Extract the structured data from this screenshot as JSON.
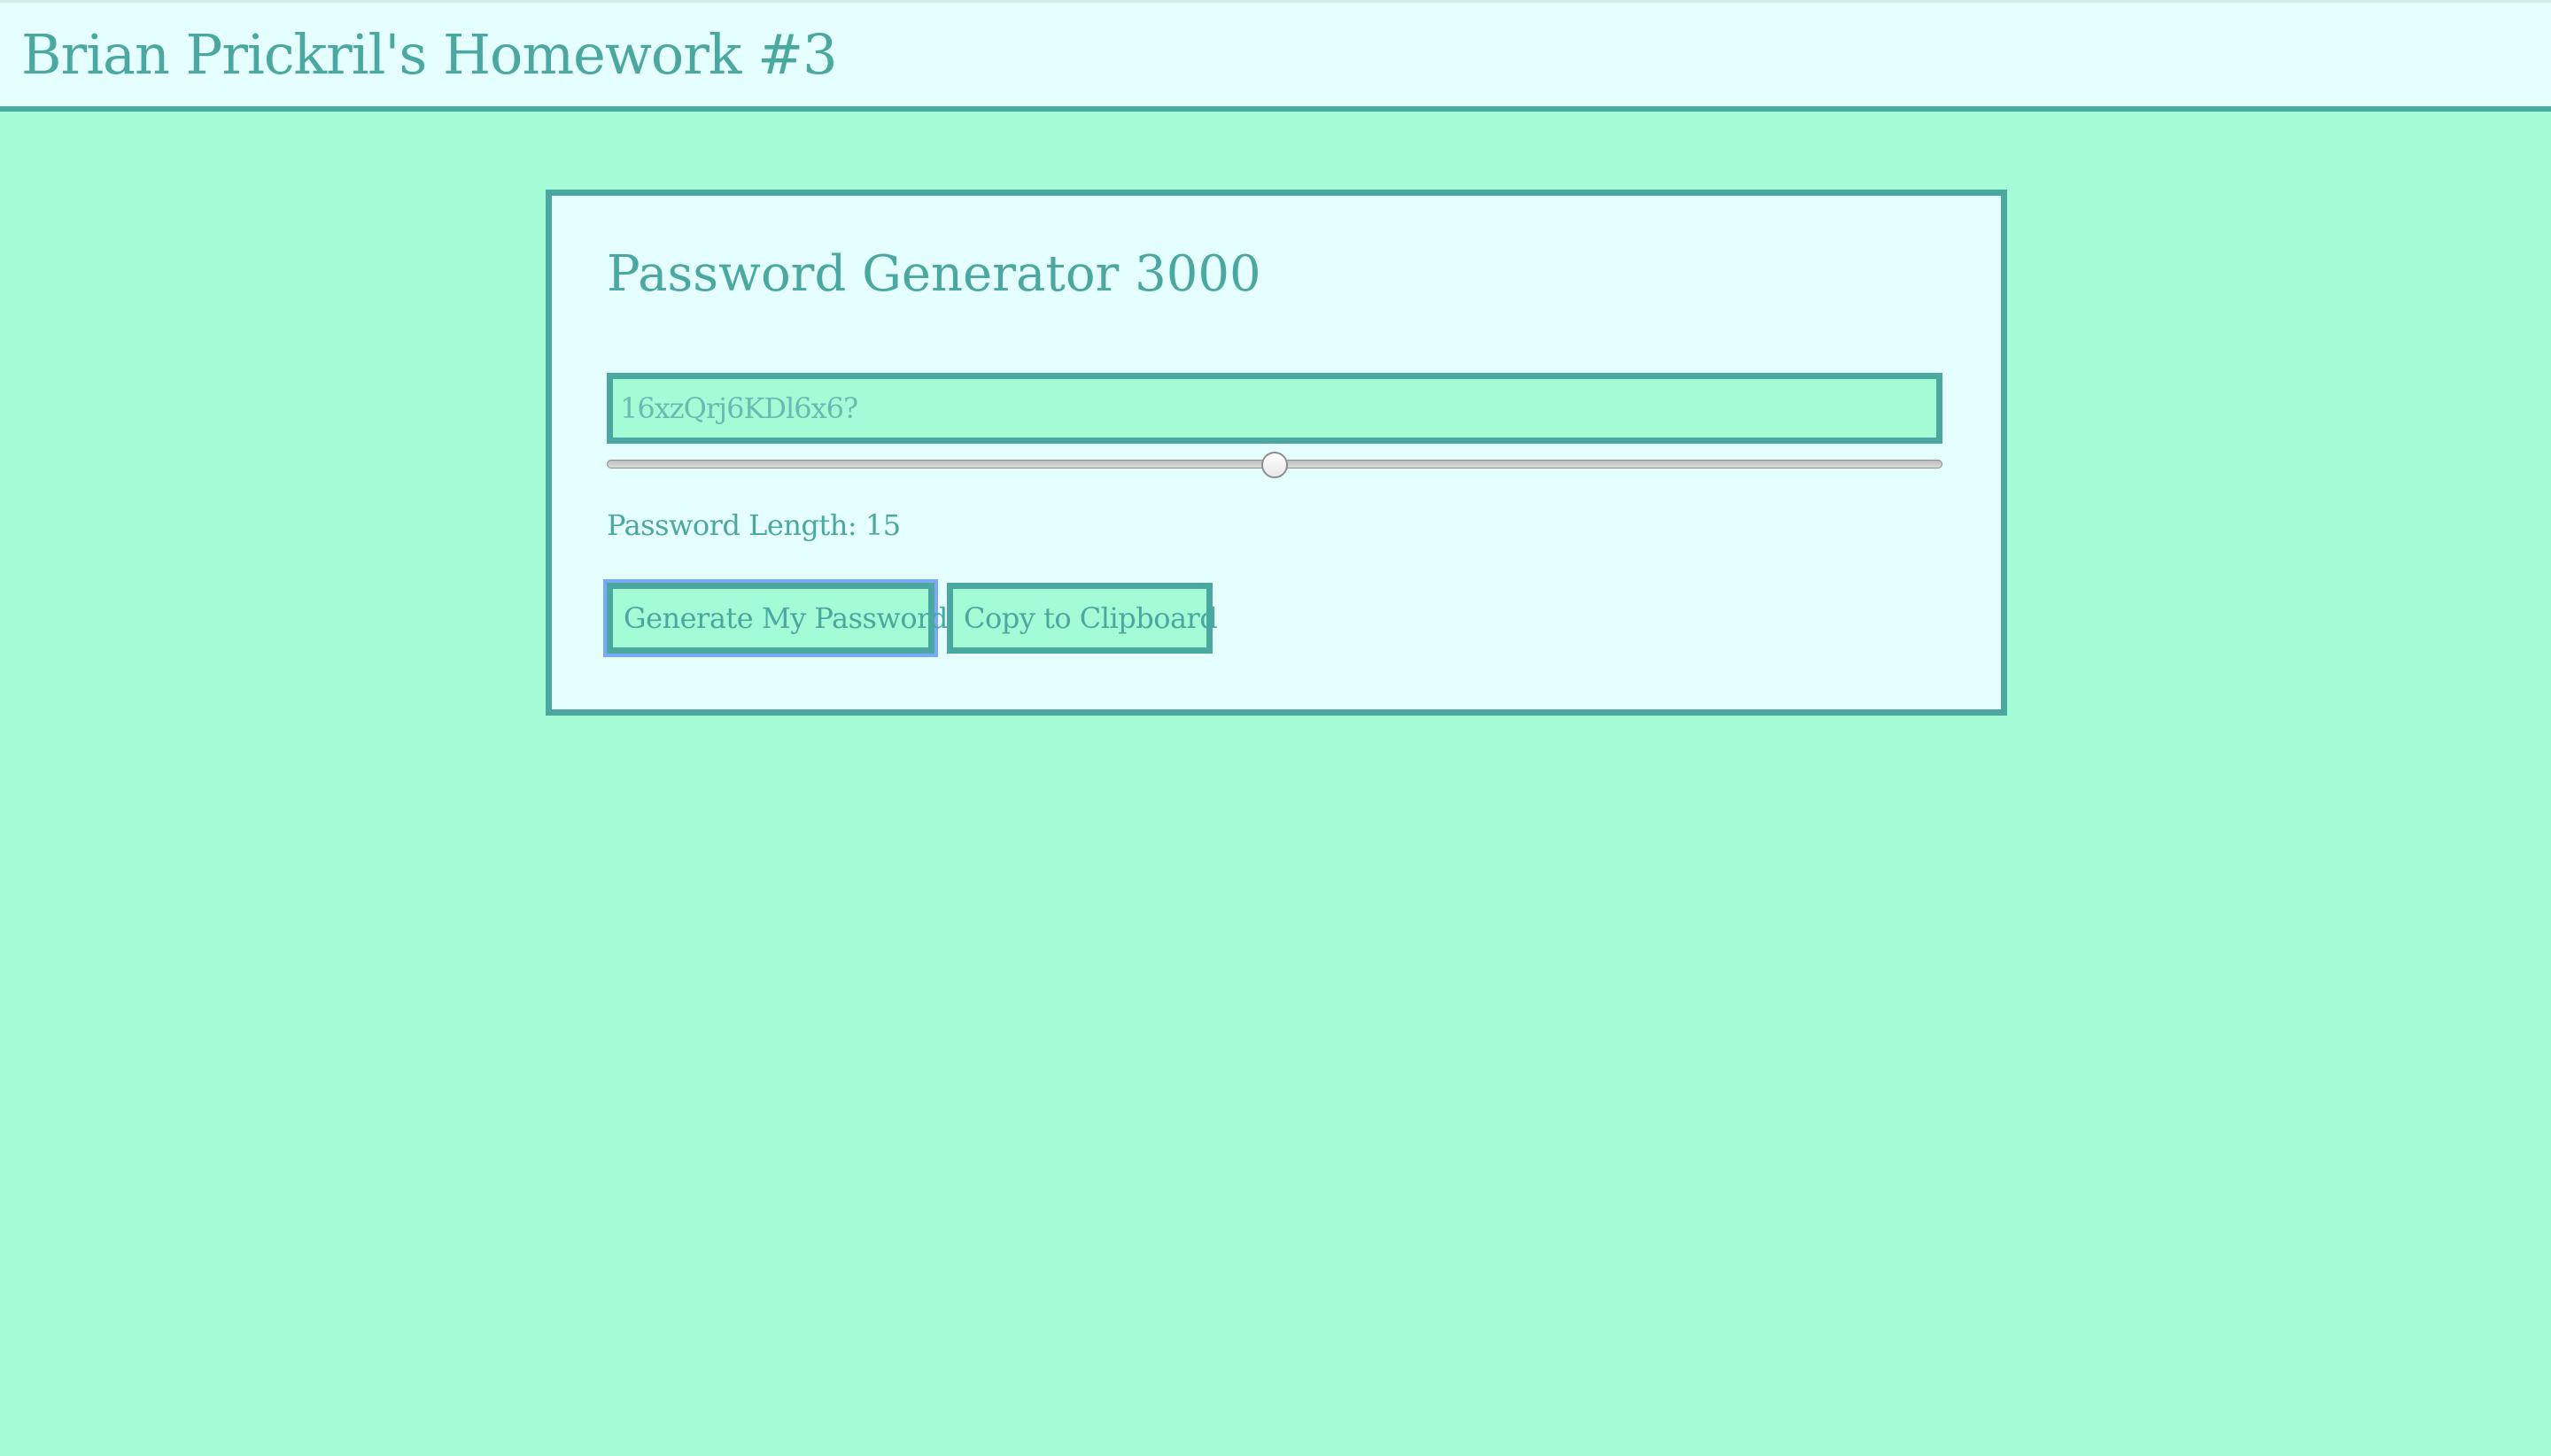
{
  "header": {
    "title": "Brian Prickril's Homework #3"
  },
  "generator": {
    "title": "Password Generator 3000",
    "password_value": "16xzQrj6KDl6x6?",
    "length_label": "Password Length: ",
    "length_value": "15",
    "slider_fraction": 0.5,
    "generate_button": "Generate My Password!",
    "copy_button": "Copy to Clipboard"
  },
  "colors": {
    "background": "#a3fcd6",
    "panel": "#e5fffe",
    "accent": "#4aa8a0",
    "focus_ring": "#7aa9f6"
  }
}
